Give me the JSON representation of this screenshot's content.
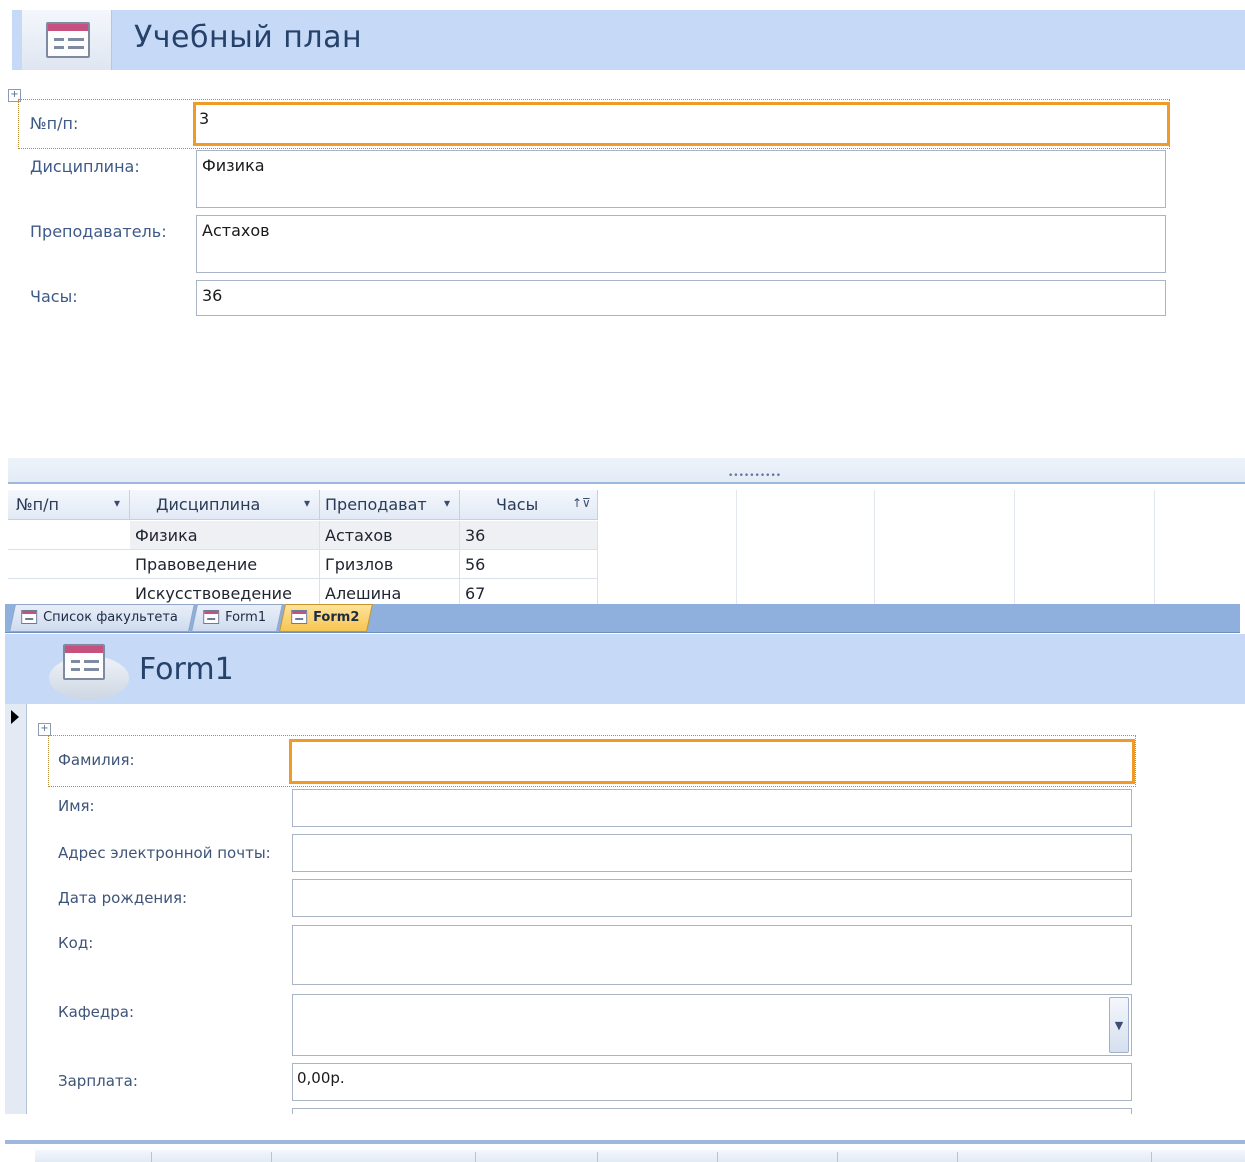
{
  "top_form": {
    "title": "Учебный план",
    "fields": [
      {
        "label": "№п/п:",
        "value": "3"
      },
      {
        "label": "Дисциплина:",
        "value": "Физика"
      },
      {
        "label": "Преподаватель:",
        "value": "Астахов"
      },
      {
        "label": "Часы:",
        "value": "36"
      }
    ]
  },
  "datasheet": {
    "columns": [
      {
        "label": "№п/п",
        "arrow": "▾"
      },
      {
        "label": "Дисциплина",
        "arrow": "▾"
      },
      {
        "label": "Преподават",
        "arrow": "▾"
      },
      {
        "label": "Часы",
        "arrow": "↑⊽"
      }
    ],
    "rows": [
      [
        "",
        "Физика",
        "Астахов",
        "36"
      ],
      [
        "",
        "Правоведение",
        "Гризлов",
        "56"
      ],
      [
        "",
        "Искусствоведение",
        "Алешина",
        "67"
      ]
    ]
  },
  "tabs": [
    {
      "label": "Список факультета",
      "active": false
    },
    {
      "label": "Form1",
      "active": false
    },
    {
      "label": "Form2",
      "active": true
    }
  ],
  "form1": {
    "title": "Form1",
    "fields": [
      {
        "label": "Фамилия:",
        "value": ""
      },
      {
        "label": "Имя:",
        "value": ""
      },
      {
        "label": "Адрес электронной почты:",
        "value": ""
      },
      {
        "label": "Дата рождения:",
        "value": ""
      },
      {
        "label": "Код:",
        "value": ""
      },
      {
        "label": "Кафедра:",
        "value": ""
      },
      {
        "label": "Зарплата:",
        "value": "0,00р."
      }
    ]
  },
  "icons": {
    "form": "form-icon",
    "add_control": "layout-selector-icon",
    "record": "current-record-arrow-icon",
    "dropdown": "chevron-down-icon"
  },
  "colors": {
    "header_bg": "#c6daf7",
    "active_field_border": "#f09a2a",
    "title_text": "#26416a",
    "tab_strip": "#8fb0dd",
    "active_tab": "#f7c552"
  }
}
